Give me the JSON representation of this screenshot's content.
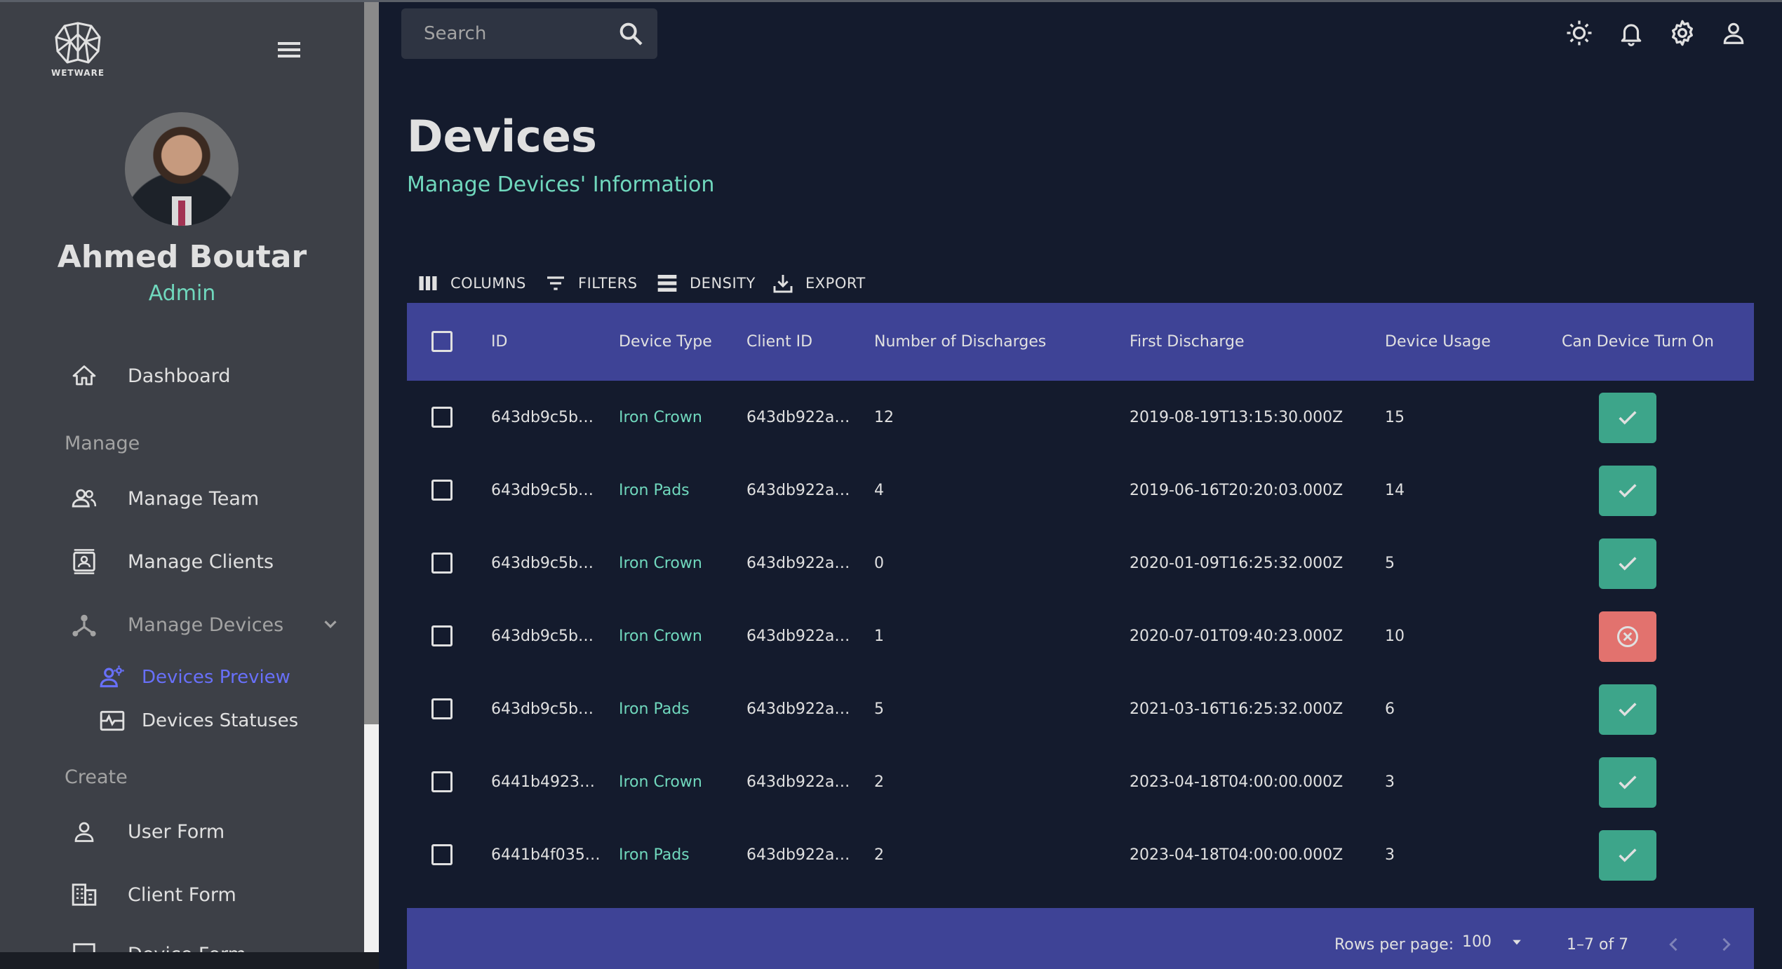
{
  "app": {
    "logo_text": "WETWARE"
  },
  "sidebar": {
    "user_name": "Ahmed Boutar",
    "user_role": "Admin",
    "items": [
      {
        "label": "Dashboard",
        "icon": "home-icon"
      },
      {
        "label": "Manage Team",
        "icon": "people-icon"
      },
      {
        "label": "Manage Clients",
        "icon": "contacts-icon"
      },
      {
        "label": "Manage Devices",
        "icon": "device-hub-icon"
      },
      {
        "label": "User Form",
        "icon": "person-icon"
      },
      {
        "label": "Client Form",
        "icon": "building-icon"
      }
    ],
    "sections": [
      "Manage",
      "Create"
    ],
    "sub_items": [
      {
        "label": "Devices Preview",
        "icon": "devices-preview-icon",
        "active": true
      },
      {
        "label": "Devices Statuses",
        "icon": "monitor-heart-icon",
        "active": false
      }
    ],
    "partial_item_label": "Device Form"
  },
  "topbar": {
    "search_placeholder": "Search",
    "icons": [
      "light-mode-icon",
      "notifications-icon",
      "settings-icon",
      "person-icon"
    ]
  },
  "header": {
    "title": "Devices",
    "subtitle": "Manage Devices' Information"
  },
  "toolbar": {
    "columns": "COLUMNS",
    "filters": "FILTERS",
    "density": "DENSITY",
    "export": "EXPORT"
  },
  "grid": {
    "columns": [
      "ID",
      "Device Type",
      "Client ID",
      "Number of Discharges",
      "First Discharge",
      "Device Usage",
      "Can Device Turn On"
    ],
    "rows": [
      {
        "id": "643db9c5b…",
        "type": "Iron Crown",
        "client": "643db922a…",
        "discharges": "12",
        "first": "2019-08-19T13:15:30.000Z",
        "usage": "15",
        "can_on": true
      },
      {
        "id": "643db9c5b…",
        "type": "Iron Pads",
        "client": "643db922a…",
        "discharges": "4",
        "first": "2019-06-16T20:20:03.000Z",
        "usage": "14",
        "can_on": true
      },
      {
        "id": "643db9c5b…",
        "type": "Iron Crown",
        "client": "643db922a…",
        "discharges": "0",
        "first": "2020-01-09T16:25:32.000Z",
        "usage": "5",
        "can_on": true
      },
      {
        "id": "643db9c5b…",
        "type": "Iron Crown",
        "client": "643db922a…",
        "discharges": "1",
        "first": "2020-07-01T09:40:23.000Z",
        "usage": "10",
        "can_on": false
      },
      {
        "id": "643db9c5b…",
        "type": "Iron Pads",
        "client": "643db922a…",
        "discharges": "5",
        "first": "2021-03-16T16:25:32.000Z",
        "usage": "6",
        "can_on": true
      },
      {
        "id": "6441b4923…",
        "type": "Iron Crown",
        "client": "643db922a…",
        "discharges": "2",
        "first": "2023-04-18T04:00:00.000Z",
        "usage": "3",
        "can_on": true
      },
      {
        "id": "6441b4f035…",
        "type": "Iron Pads",
        "client": "643db922a…",
        "discharges": "2",
        "first": "2023-04-18T04:00:00.000Z",
        "usage": "3",
        "can_on": true
      }
    ],
    "footer": {
      "rows_per_page_label": "Rows per page:",
      "rows_per_page_value": "100",
      "range": "1–7 of 7"
    }
  },
  "colors": {
    "accent_green": "#70d8bd",
    "header_blue": "#3e4396",
    "ok_button": "#3da58a",
    "fail_button": "#e2726e",
    "active_nav": "#6870fa"
  }
}
